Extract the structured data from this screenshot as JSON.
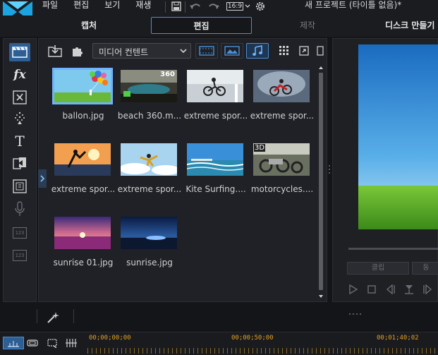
{
  "menu": {
    "items": [
      "파일",
      "편집",
      "보기",
      "재생"
    ],
    "aspect_ratio": "16:9",
    "project_title": "새 프로젝트 (타이틀 없음)*"
  },
  "tabs": [
    {
      "label": "캡처",
      "state": "normal"
    },
    {
      "label": "편집",
      "state": "active"
    },
    {
      "label": "제작",
      "state": "disabled"
    },
    {
      "label": "디스크 만들기",
      "state": "normal"
    }
  ],
  "rooms": [
    {
      "icon": "media-room-icon",
      "active": true
    },
    {
      "icon": "fx-room-icon",
      "label": "fx"
    },
    {
      "icon": "pip-objects-icon"
    },
    {
      "icon": "particle-room-icon"
    },
    {
      "icon": "title-room-icon",
      "label": "T"
    },
    {
      "icon": "transition-room-icon"
    },
    {
      "icon": "audio-mixing-icon"
    },
    {
      "icon": "voice-over-icon"
    },
    {
      "icon": "chapter-room-icon",
      "label": "123"
    },
    {
      "icon": "subtitle-room-icon",
      "label": "123"
    }
  ],
  "library": {
    "content_dropdown": "미디어 컨텐트",
    "filters": [
      {
        "icon": "video-filter-icon",
        "on": false
      },
      {
        "icon": "image-filter-icon",
        "on": false
      },
      {
        "icon": "audio-filter-icon",
        "on": true
      }
    ],
    "items": [
      {
        "caption": "ballon.jpg",
        "thumb": "balloons",
        "selected": true
      },
      {
        "caption": "beach 360.m...",
        "thumb": "beach360",
        "badge": "360"
      },
      {
        "caption": "extreme spor...",
        "thumb": "bmx1"
      },
      {
        "caption": "extreme spor...",
        "thumb": "moto"
      },
      {
        "caption": "extreme spor...",
        "thumb": "sunsetjump"
      },
      {
        "caption": "extreme spor...",
        "thumb": "skydive"
      },
      {
        "caption": "Kite Surfing....",
        "thumb": "kite"
      },
      {
        "caption": "motorcycles....",
        "thumb": "motorcycles",
        "badge3d": "3D"
      },
      {
        "caption": "sunrise 01.jpg",
        "thumb": "sunrise1"
      },
      {
        "caption": "sunrise.jpg",
        "thumb": "sunrise2"
      }
    ]
  },
  "preview": {
    "buttons": [
      "클립",
      "동"
    ]
  },
  "timeline": {
    "timecodes": [
      "00;00;00;00",
      "00;00;50;00",
      "00;01;40;02"
    ]
  },
  "colors": {
    "accent": "#4a8fd8",
    "timecode": "#e2a020",
    "selection": "#6fb2ff"
  }
}
